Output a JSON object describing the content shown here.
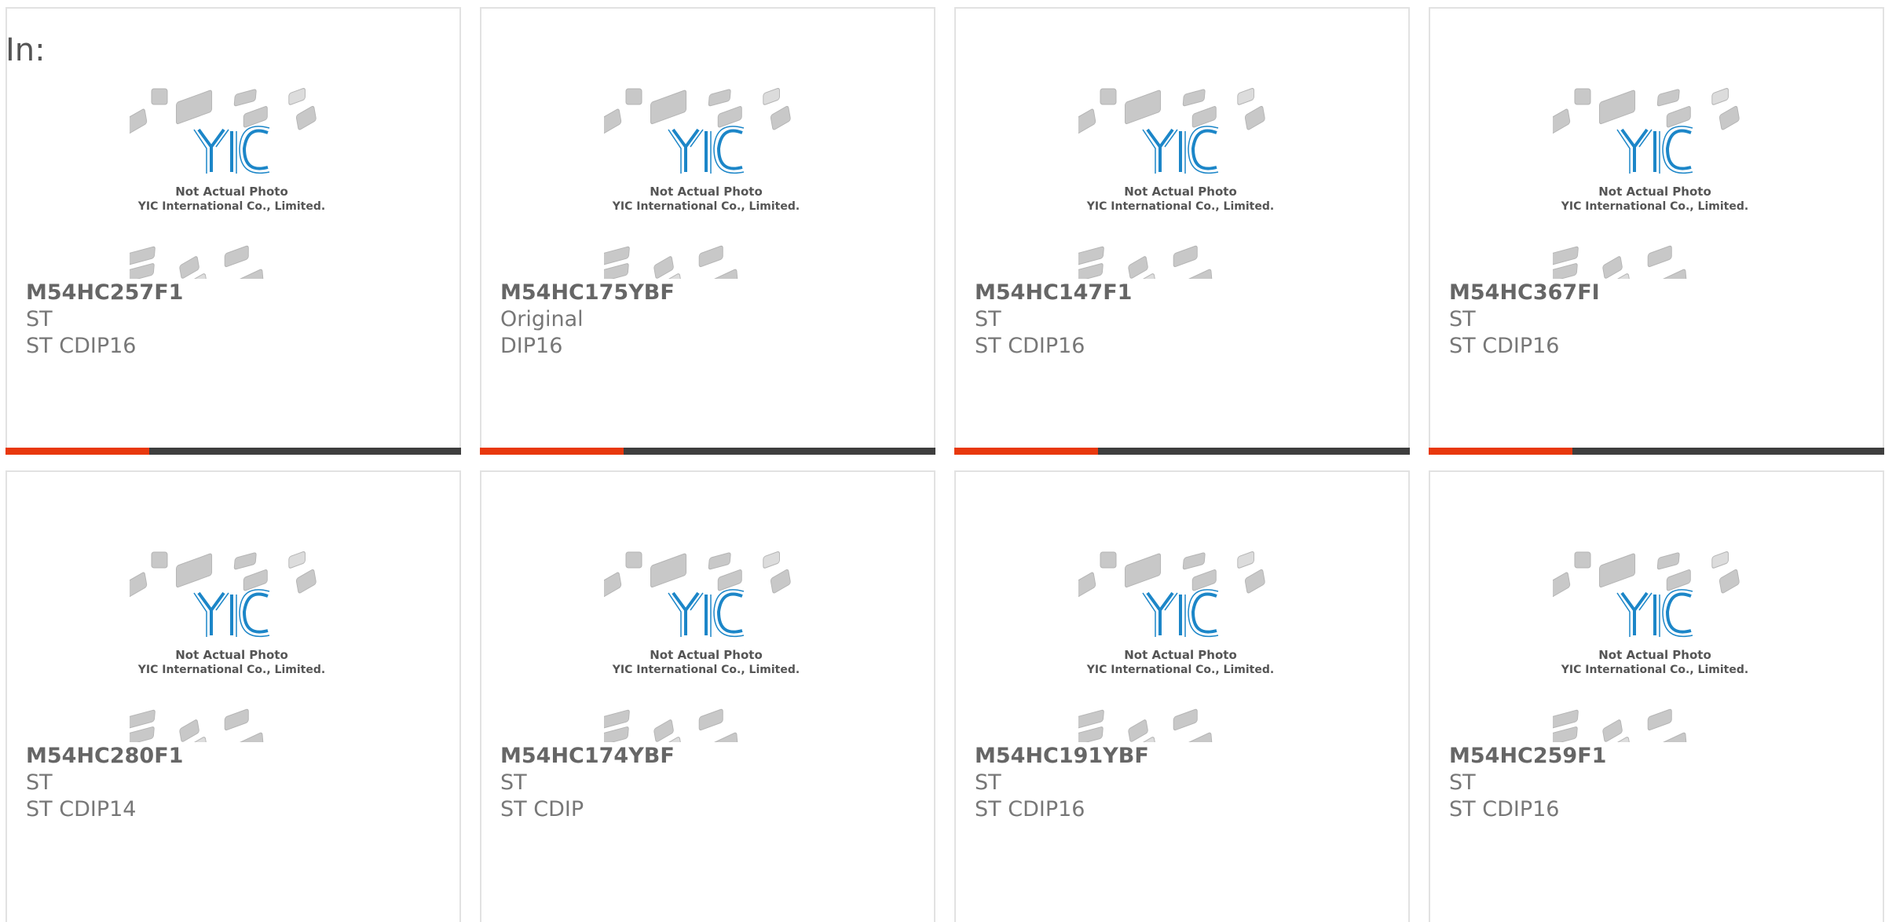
{
  "page": {
    "label": "In:"
  },
  "placeholder": {
    "line1": "Not Actual Photo",
    "line2": "YIC International Co., Limited.",
    "logo_text": "YIC",
    "colors": {
      "logo": "#1c86c8",
      "chips": "#c8c8c8"
    }
  },
  "products": [
    {
      "part_number": "M54HC257F1",
      "manufacturer": "ST",
      "package": "ST CDIP16"
    },
    {
      "part_number": "M54HC175YBF",
      "manufacturer": "Original",
      "package": "DIP16"
    },
    {
      "part_number": "M54HC147F1",
      "manufacturer": "ST",
      "package": "ST CDIP16"
    },
    {
      "part_number": "M54HC367FI",
      "manufacturer": "ST",
      "package": "ST CDIP16"
    },
    {
      "part_number": "M54HC280F1",
      "manufacturer": "ST",
      "package": "ST CDIP14"
    },
    {
      "part_number": "M54HC174YBF",
      "manufacturer": "ST",
      "package": "ST CDIP"
    },
    {
      "part_number": "M54HC191YBF",
      "manufacturer": "ST",
      "package": "ST CDIP16"
    },
    {
      "part_number": "M54HC259F1",
      "manufacturer": "ST",
      "package": "ST CDIP16"
    }
  ],
  "colors": {
    "accent_bar": "#e8380d",
    "bar": "#3e3e3e",
    "border": "#e2e2e2"
  }
}
